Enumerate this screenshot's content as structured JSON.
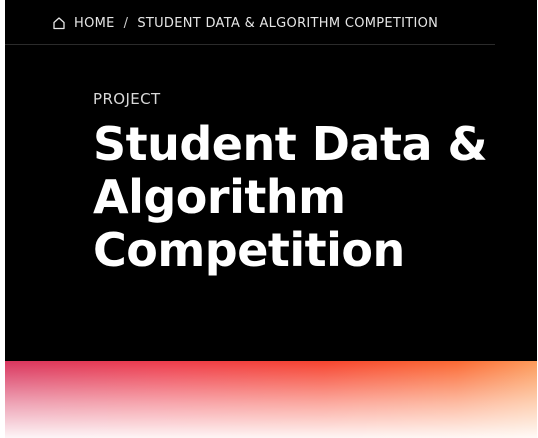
{
  "breadcrumb": {
    "home_icon": "home-icon",
    "home_label": "HOME",
    "separator": "/",
    "current_label": "STUDENT DATA & ALGORITHM COMPETITION"
  },
  "hero": {
    "eyebrow": "PROJECT",
    "title_lines": [
      "Student Data &",
      "Algorithm",
      "Competition"
    ]
  },
  "colors": {
    "hero_background": "#000000",
    "text": "#ffffff",
    "gradient_start": "#d9365f",
    "gradient_mid": "#f7442f",
    "gradient_end": "#fc9a5a"
  }
}
